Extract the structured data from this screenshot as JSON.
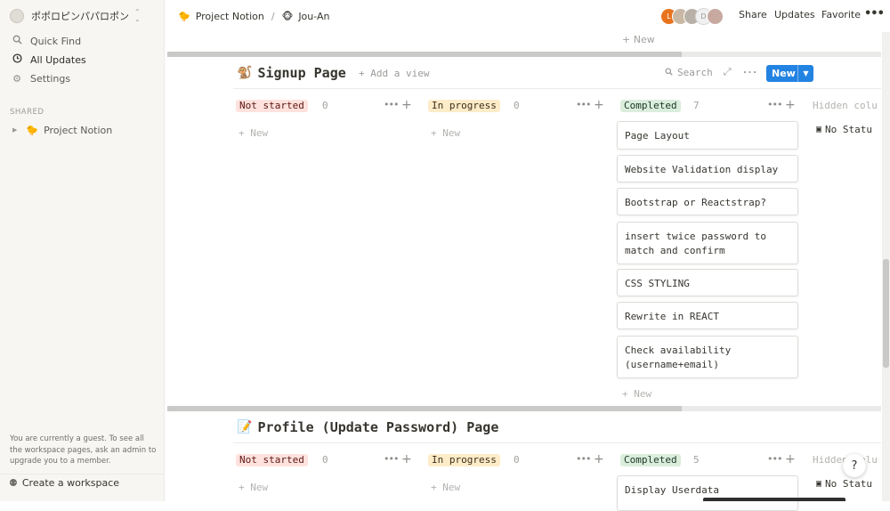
{
  "sidebar": {
    "workspace_name": "ポポロピンパパロポン",
    "items": [
      {
        "label": "Quick Find",
        "icon": "search-icon"
      },
      {
        "label": "All Updates",
        "icon": "clock-icon"
      },
      {
        "label": "Settings",
        "icon": "gear-icon"
      }
    ],
    "section_label": "SHARED",
    "page": {
      "emoji": "🐤",
      "label": "Project Notion"
    },
    "guest_message": "You are currently a guest. To see all the workspace pages, ask an admin to upgrade you to a member.",
    "create_label": "Create a workspace"
  },
  "topbar": {
    "breadcrumb": [
      {
        "emoji": "🐤",
        "label": "Project Notion"
      },
      {
        "emoji": "🐵",
        "label": "Jou-An"
      }
    ],
    "separator": "/",
    "avatars": [
      {
        "initial": "L",
        "color": "#e8731d"
      },
      {
        "initial": "",
        "color": "#c9b8a4"
      },
      {
        "initial": "",
        "color": "#b9b1a8"
      },
      {
        "initial": "D",
        "color": "#d6d6d6"
      },
      {
        "initial": "",
        "color": "#c7a9a0"
      }
    ],
    "share_label": "Share",
    "updates_label": "Updates",
    "favorite_label": "Favorite",
    "more_label": "•••"
  },
  "board_top": {
    "new_label": "+ New"
  },
  "signup": {
    "emoji": "🐒",
    "title": "Signup Page",
    "add_view": "+ Add a view",
    "search_label": "Search",
    "new_button": "New",
    "columns": [
      {
        "label": "Not started",
        "count": "0",
        "new_label": "+ New"
      },
      {
        "label": "In progress",
        "count": "0",
        "new_label": "+ New"
      },
      {
        "label": "Completed",
        "count": "7",
        "new_label": "+ New"
      }
    ],
    "hidden_label": "Hidden colu",
    "no_status_label": "No Statu",
    "cards": [
      "Page Layout",
      "Website Validation display",
      "Bootstrap or Reactstrap?",
      "insert twice password to match and confirm",
      "CSS STYLING",
      "Rewrite in REACT",
      "Check availability (username+email)"
    ]
  },
  "profile": {
    "emoji": "📝",
    "title": "Profile (Update Password) Page",
    "columns": [
      {
        "label": "Not started",
        "count": "0",
        "new_label": "+ New"
      },
      {
        "label": "In progress",
        "count": "0",
        "new_label": "+ New"
      },
      {
        "label": "Completed",
        "count": "5"
      }
    ],
    "hidden_label": "Hidden colu",
    "no_status_label": "No Statu",
    "cards": [
      "Display Userdata"
    ]
  },
  "help_label": "?",
  "colors": {
    "accent": "#2383e2",
    "not_started": "#ffe2dd",
    "in_progress": "#fdecc8",
    "completed": "#dbeddb"
  }
}
